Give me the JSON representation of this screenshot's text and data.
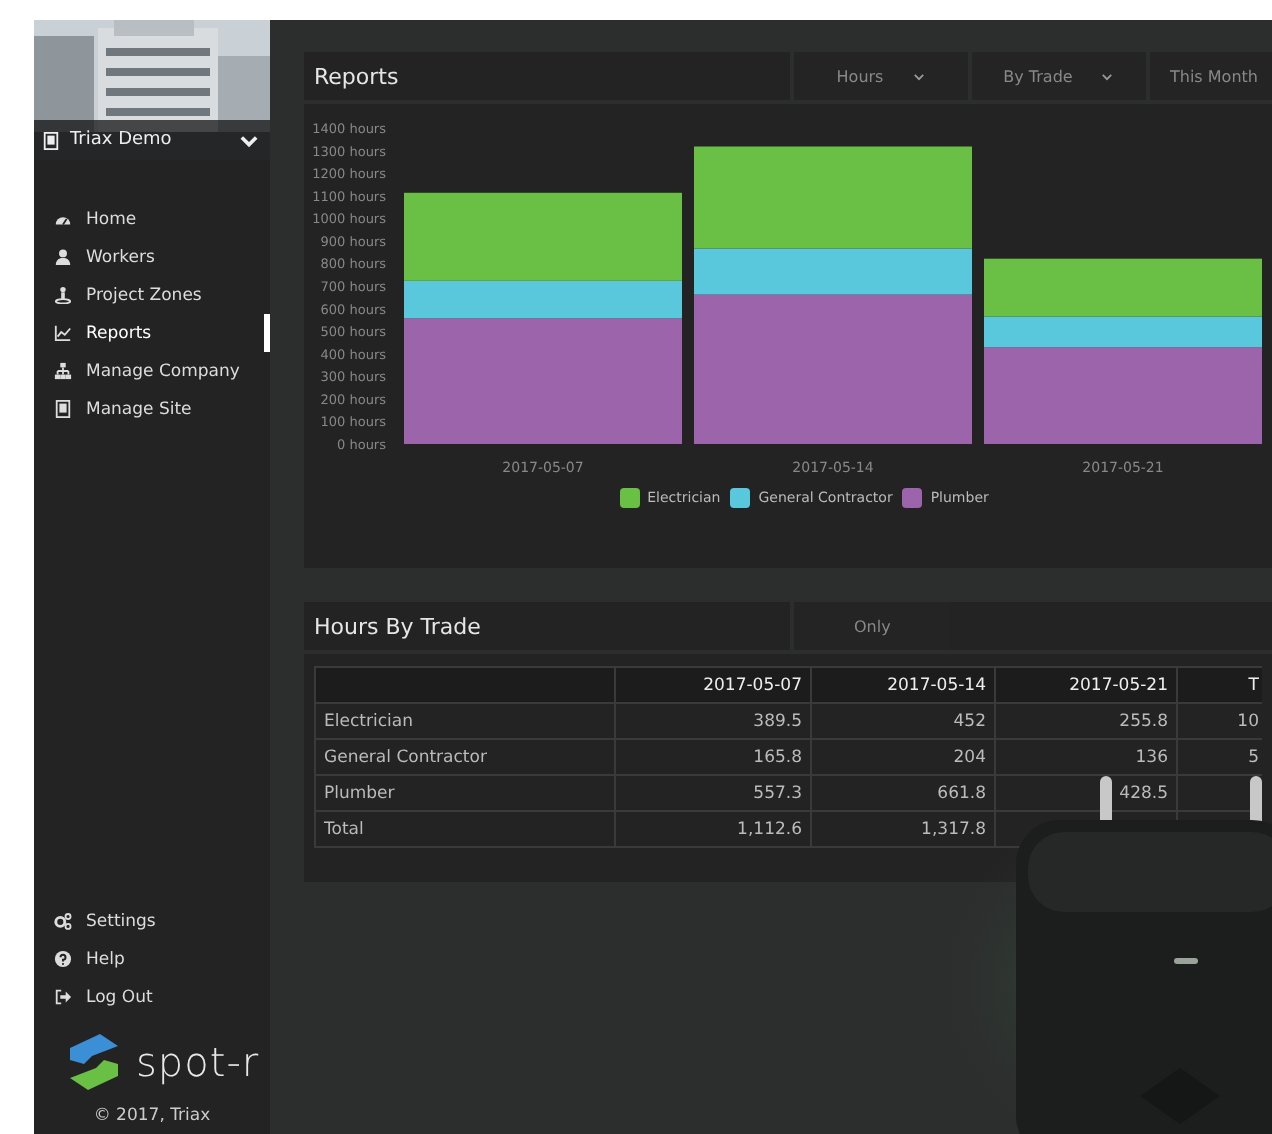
{
  "sidebar": {
    "site_selector": {
      "label": "Triax Demo"
    },
    "nav_items": [
      {
        "label": "Home",
        "selected": false
      },
      {
        "label": "Workers",
        "selected": false
      },
      {
        "label": "Project Zones",
        "selected": false
      },
      {
        "label": "Reports",
        "selected": true
      },
      {
        "label": "Manage Company",
        "selected": false
      },
      {
        "label": "Manage Site",
        "selected": false
      }
    ],
    "bottom_items": [
      {
        "label": "Settings"
      },
      {
        "label": "Help"
      },
      {
        "label": "Log Out"
      }
    ],
    "logo": {
      "text": "spot-r"
    },
    "copyright": "© 2017, Triax"
  },
  "reports_panel": {
    "title": "Reports",
    "filters": [
      {
        "label": "Hours",
        "dropdown": true
      },
      {
        "label": "By Trade",
        "dropdown": true
      },
      {
        "label": "This Month",
        "dropdown": false
      }
    ],
    "chart_data": {
      "type": "bar",
      "stacked": true,
      "legend": "bottom",
      "categories": [
        "2017-05-07",
        "2017-05-14",
        "2017-05-21"
      ],
      "series": [
        {
          "name": "Electrician",
          "color": "#6abf45",
          "values": [
            390,
            452,
            256
          ]
        },
        {
          "name": "General Contractor",
          "color": "#5ac8dc",
          "values": [
            166,
            204,
            136
          ]
        },
        {
          "name": "Plumber",
          "color": "#9b64ab",
          "values": [
            557,
            662,
            429
          ]
        }
      ],
      "ylim": [
        0,
        1400
      ],
      "yticks": [
        {
          "value": 0,
          "label": "0 hours"
        },
        {
          "value": 100,
          "label": "100 hours"
        },
        {
          "value": 200,
          "label": "200 hours"
        },
        {
          "value": 300,
          "label": "300 hours"
        },
        {
          "value": 400,
          "label": "400 hours"
        },
        {
          "value": 500,
          "label": "500 hours"
        },
        {
          "value": 600,
          "label": "600 hours"
        },
        {
          "value": 700,
          "label": "700 hours"
        },
        {
          "value": 800,
          "label": "800 hours"
        },
        {
          "value": 900,
          "label": "900 hours"
        },
        {
          "value": 1000,
          "label": "1000 hours"
        },
        {
          "value": 1100,
          "label": "1100 hours"
        },
        {
          "value": 1200,
          "label": "1200 hours"
        },
        {
          "value": 1300,
          "label": "1300 hours"
        },
        {
          "value": 1400,
          "label": "1400 hours"
        }
      ]
    }
  },
  "hours_panel": {
    "title": "Hours By Trade",
    "button": "Only",
    "table": {
      "columns": [
        "2017-05-07",
        "2017-05-14",
        "2017-05-21",
        "T"
      ],
      "rows": [
        {
          "label": "Electrician",
          "values": [
            "389.5",
            "452",
            "255.8",
            "10"
          ]
        },
        {
          "label": "General Contractor",
          "values": [
            "165.8",
            "204",
            "136",
            "5"
          ]
        },
        {
          "label": "Plumber",
          "values": [
            "557.3",
            "661.8",
            "428.5"
          ]
        },
        {
          "label": "Total",
          "values": [
            "1,112.6",
            "1,317.8"
          ]
        }
      ]
    }
  }
}
